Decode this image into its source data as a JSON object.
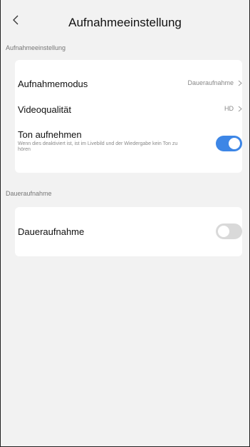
{
  "header": {
    "title": "Aufnahmeeinstellung",
    "back_icon": "chevron-left-icon"
  },
  "sections": [
    {
      "label": "Aufnahmeeinstellung",
      "rows": [
        {
          "label": "Aufnahmemodus",
          "value": "Daueraufnahme",
          "icon": "chevron-right-icon"
        },
        {
          "label": "Videoqualität",
          "value": "HD",
          "icon": "chevron-right-icon"
        },
        {
          "label": "Ton aufnehmen",
          "description": "Wenn dies deaktiviert ist, ist im Livebild und der Wiedergabe kein Ton zu hören",
          "toggle": true
        }
      ]
    },
    {
      "label": "Daueraufnahme",
      "rows": [
        {
          "label": "Daueraufnahme",
          "toggle": false
        }
      ]
    }
  ],
  "colors": {
    "accent": "#3d86e6",
    "toggle_off": "#d9d9d9",
    "background": "#f2f2f2",
    "card": "#ffffff"
  }
}
